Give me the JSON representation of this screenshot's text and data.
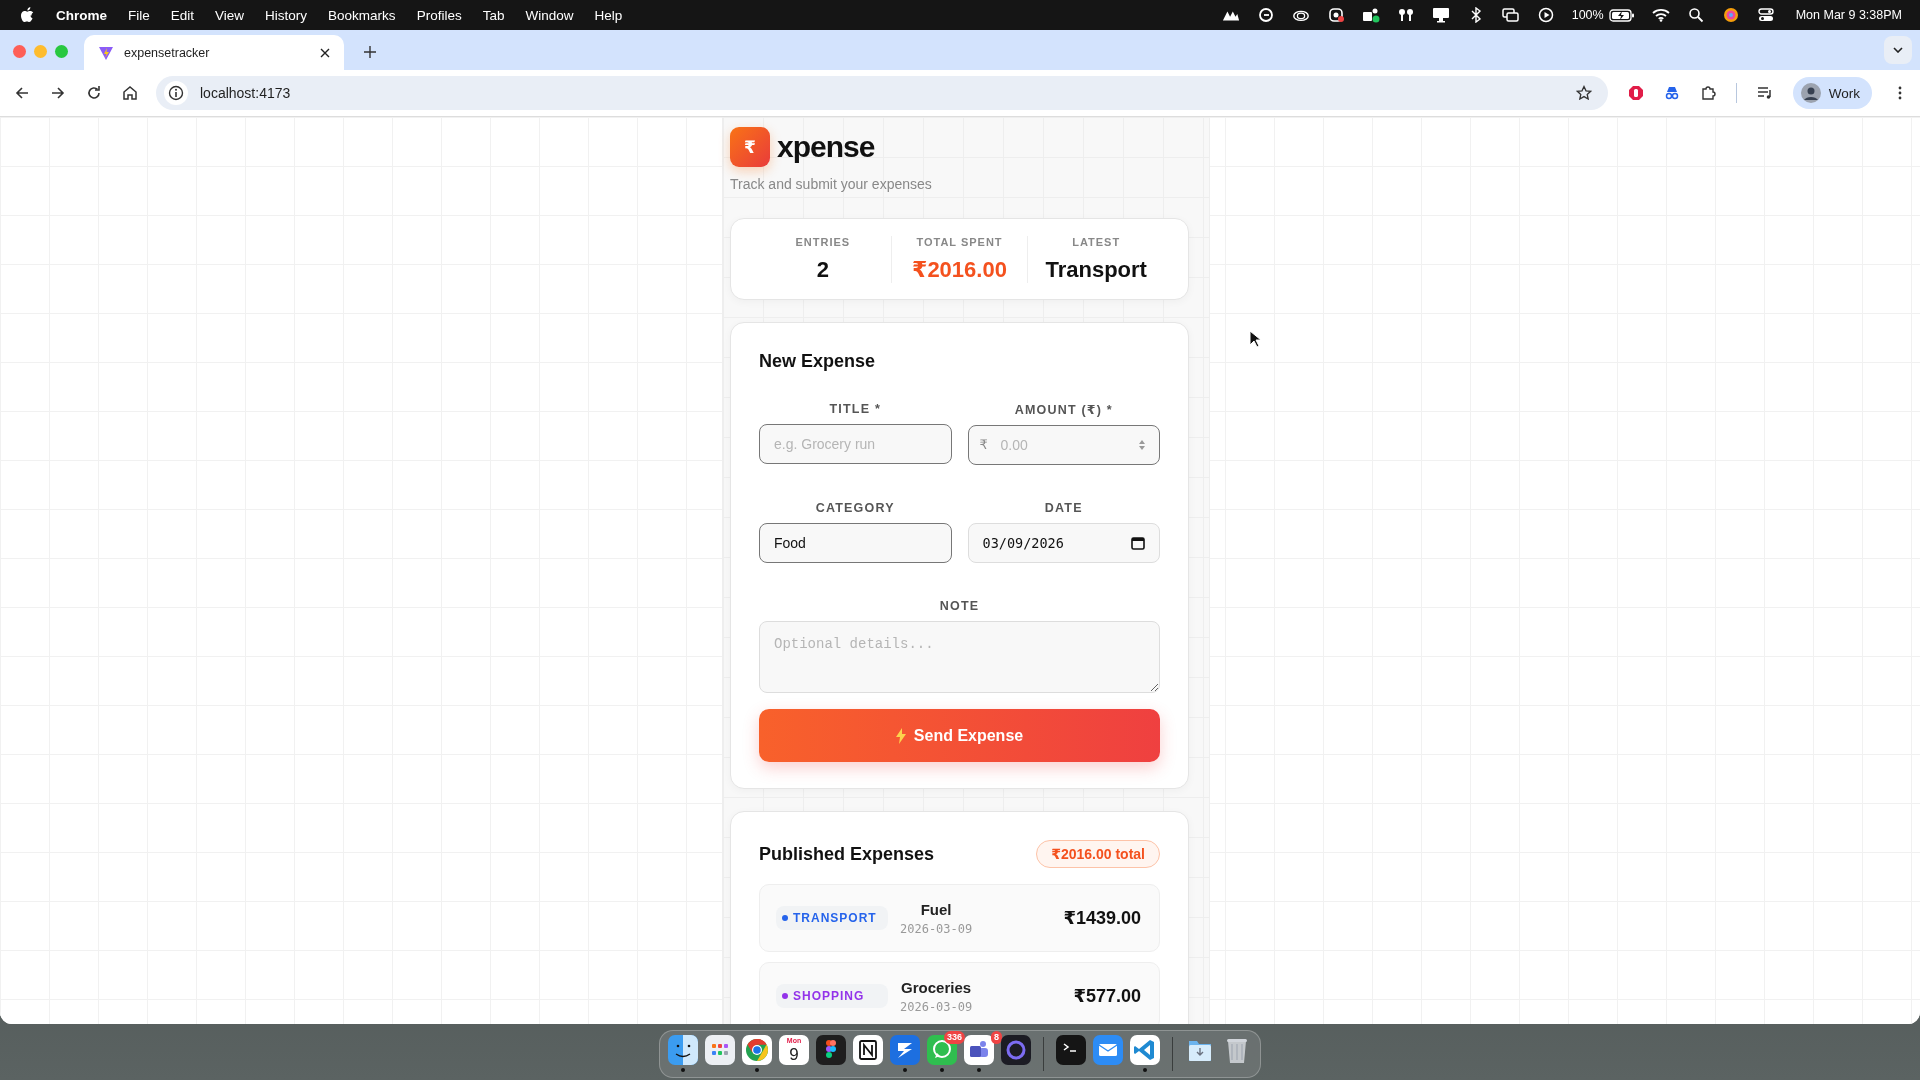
{
  "menubar": {
    "app": "Chrome",
    "menus": [
      "File",
      "Edit",
      "View",
      "History",
      "Bookmarks",
      "Profiles",
      "Tab",
      "Window",
      "Help"
    ],
    "battery": "100%",
    "clock": "Mon Mar 9  3:38PM"
  },
  "browser": {
    "tabs": [
      {
        "title": "expensetracker",
        "selected": true
      }
    ],
    "url": "localhost:4173",
    "profile": "Work"
  },
  "app": {
    "logo_symbol": "₹",
    "brand": "xpense",
    "tagline": "Track and submit your expenses",
    "stats": [
      {
        "label": "ENTRIES",
        "value": "2",
        "accent": false
      },
      {
        "label": "TOTAL SPENT",
        "value": "₹2016.00",
        "accent": true
      },
      {
        "label": "LATEST",
        "value": "Transport",
        "accent": false
      }
    ],
    "form": {
      "title": "New Expense",
      "fields": [
        {
          "label": "TITLE *",
          "kind": "text",
          "placeholder": "e.g. Grocery run"
        },
        {
          "label": "AMOUNT (₹) *",
          "kind": "number",
          "prefix": "₹",
          "placeholder": "0.00"
        },
        {
          "label": "CATEGORY",
          "kind": "select",
          "value": "Food"
        },
        {
          "label": "DATE",
          "kind": "date",
          "value": "03/09/2026"
        },
        {
          "label": "NOTE",
          "kind": "textarea",
          "placeholder": "Optional details..."
        }
      ],
      "submit": "Send Expense"
    },
    "list": {
      "title": "Published Expenses",
      "total": "₹2016.00 total",
      "items": [
        {
          "category": "TRANSPORT",
          "color": "#2563eb",
          "title": "Fuel",
          "date": "2026-03-09",
          "amount": "₹1439.00"
        },
        {
          "category": "SHOPPING",
          "color": "#9333ea",
          "title": "Groceries",
          "date": "2026-03-09",
          "amount": "₹577.00"
        }
      ]
    }
  },
  "dock": {
    "groups": [
      [
        {
          "kind": "finder",
          "running": true
        },
        {
          "kind": "launchpad",
          "running": false
        },
        {
          "kind": "chrome",
          "running": true
        },
        {
          "kind": "calendar",
          "running": false,
          "weekday": "Mon",
          "day": "9"
        },
        {
          "kind": "figma",
          "running": false
        },
        {
          "kind": "notion",
          "running": false
        },
        {
          "kind": "arrow",
          "running": true
        },
        {
          "kind": "chat",
          "running": true,
          "badge": "336"
        },
        {
          "kind": "teams",
          "running": true,
          "badge": "8"
        },
        {
          "kind": "ring",
          "running": false
        }
      ],
      [
        {
          "kind": "terminal",
          "running": false
        },
        {
          "kind": "mail",
          "running": false
        },
        {
          "kind": "code",
          "running": true
        }
      ],
      [
        {
          "kind": "downloads",
          "running": false
        },
        {
          "kind": "trash",
          "running": false
        }
      ]
    ]
  }
}
